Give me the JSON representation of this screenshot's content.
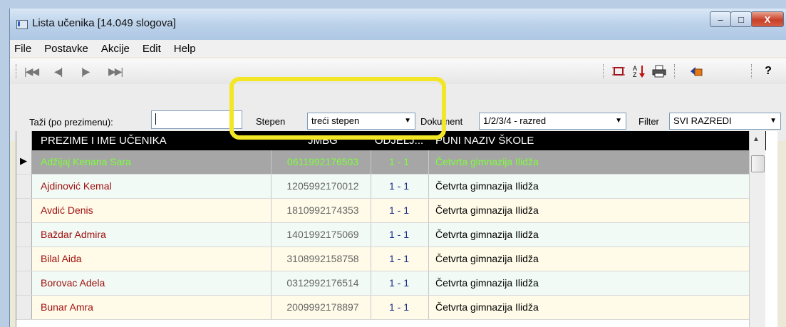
{
  "window": {
    "title": "Lista učenika  [14.049 slogova]"
  },
  "win_controls": {
    "minimize": "–",
    "maximize": "□",
    "close": "X"
  },
  "menu": [
    "File",
    "Postavke",
    "Akcije",
    "Edit",
    "Help"
  ],
  "toolbar": {
    "nav": {
      "first": "|◀◀",
      "prev": "◀|",
      "next": "|▶",
      "last": "▶▶|"
    },
    "help": "?"
  },
  "filters": {
    "search_label": "Taži (po prezimenu):",
    "search_value": "",
    "stepen_label": "Stepen",
    "stepen_value": "treći stepen",
    "dokument_label": "Dokument",
    "dokument_value": "1/2/3/4 - razred",
    "filter_label": "Filter",
    "filter_value": "SVI RAZREDI"
  },
  "table": {
    "columns": [
      "PREZIME I IME UČENIKA",
      "JMBG",
      "ODJELJ...",
      "PUNI NAZIV ŠKOLE"
    ],
    "rows": [
      {
        "name": "Adžijaj  Kenana Sara",
        "jmbg": "0611992176503",
        "odjeljenje": "1 - 1",
        "skola": "Četvrta gimnazija Ilidža",
        "selected": true
      },
      {
        "name": "Ajdinović  Kemal",
        "jmbg": "1205992170012",
        "odjeljenje": "1 - 1",
        "skola": "Četvrta gimnazija Ilidža"
      },
      {
        "name": "Avdić  Denis",
        "jmbg": "1810992174353",
        "odjeljenje": "1 - 1",
        "skola": "Četvrta gimnazija Ilidža"
      },
      {
        "name": "Baždar  Admira",
        "jmbg": "1401992175069",
        "odjeljenje": "1 - 1",
        "skola": "Četvrta gimnazija Ilidža"
      },
      {
        "name": "Bilal  Aida",
        "jmbg": "3108992158758",
        "odjeljenje": "1 - 1",
        "skola": "Četvrta gimnazija Ilidža"
      },
      {
        "name": "Borovac  Adela",
        "jmbg": "0312992176514",
        "odjeljenje": "1 - 1",
        "skola": "Četvrta gimnazija Ilidža"
      },
      {
        "name": "Bunar  Amra",
        "jmbg": "2009992178897",
        "odjeljenje": "1 - 1",
        "skola": "Četvrta gimnazija Ilidža"
      }
    ]
  },
  "colors": {
    "selected_row_bg": "#a6a6a6",
    "selected_text": "#7dff3a",
    "name_text": "#a01010",
    "jmbg_text": "#666666",
    "odjeljenje_text": "#1a2e8a",
    "row_even": "#fffbe8",
    "row_odd": "#f1faf4",
    "highlight": "#f3e626"
  }
}
